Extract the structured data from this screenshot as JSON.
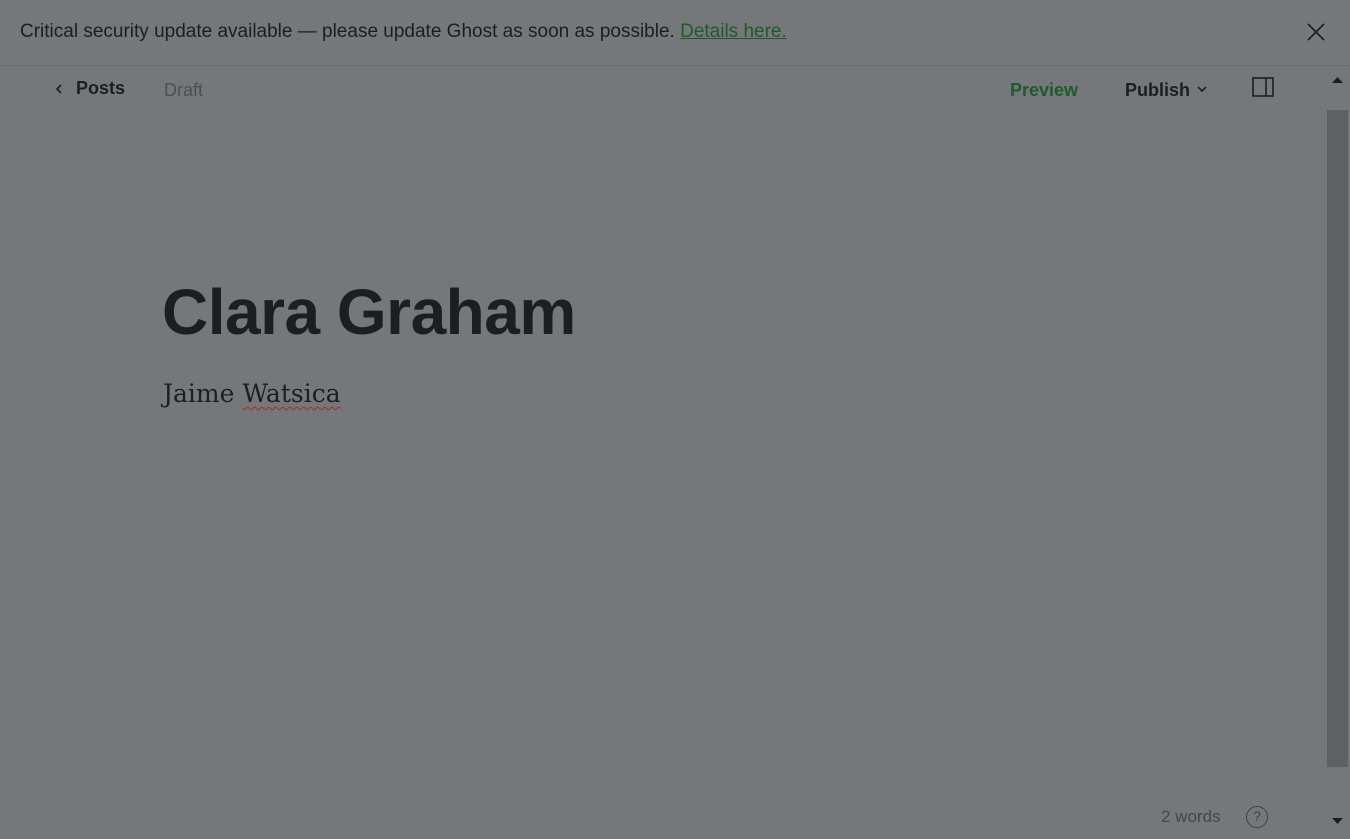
{
  "banner": {
    "message": "Critical security update available — please update Ghost as soon as possible.",
    "link_label": "Details here.",
    "close_icon": "close-icon"
  },
  "topbar": {
    "back_label": "Posts",
    "back_icon": "chevron-left-icon",
    "status": "Draft",
    "preview_label": "Preview",
    "publish_label": "Publish",
    "publish_icon": "chevron-down-icon",
    "sidebar_icon": "sidebar-toggle-icon"
  },
  "post": {
    "title": "Clara Graham",
    "body_first": "Jaime",
    "body_misspelled": "Watsica"
  },
  "footer": {
    "word_count": "2 words",
    "help_label": "?"
  },
  "colors": {
    "overlay": "#75777a",
    "accent": "#1f5a2c",
    "text": "#1c1e21",
    "spellcheck": "#b0232f"
  }
}
